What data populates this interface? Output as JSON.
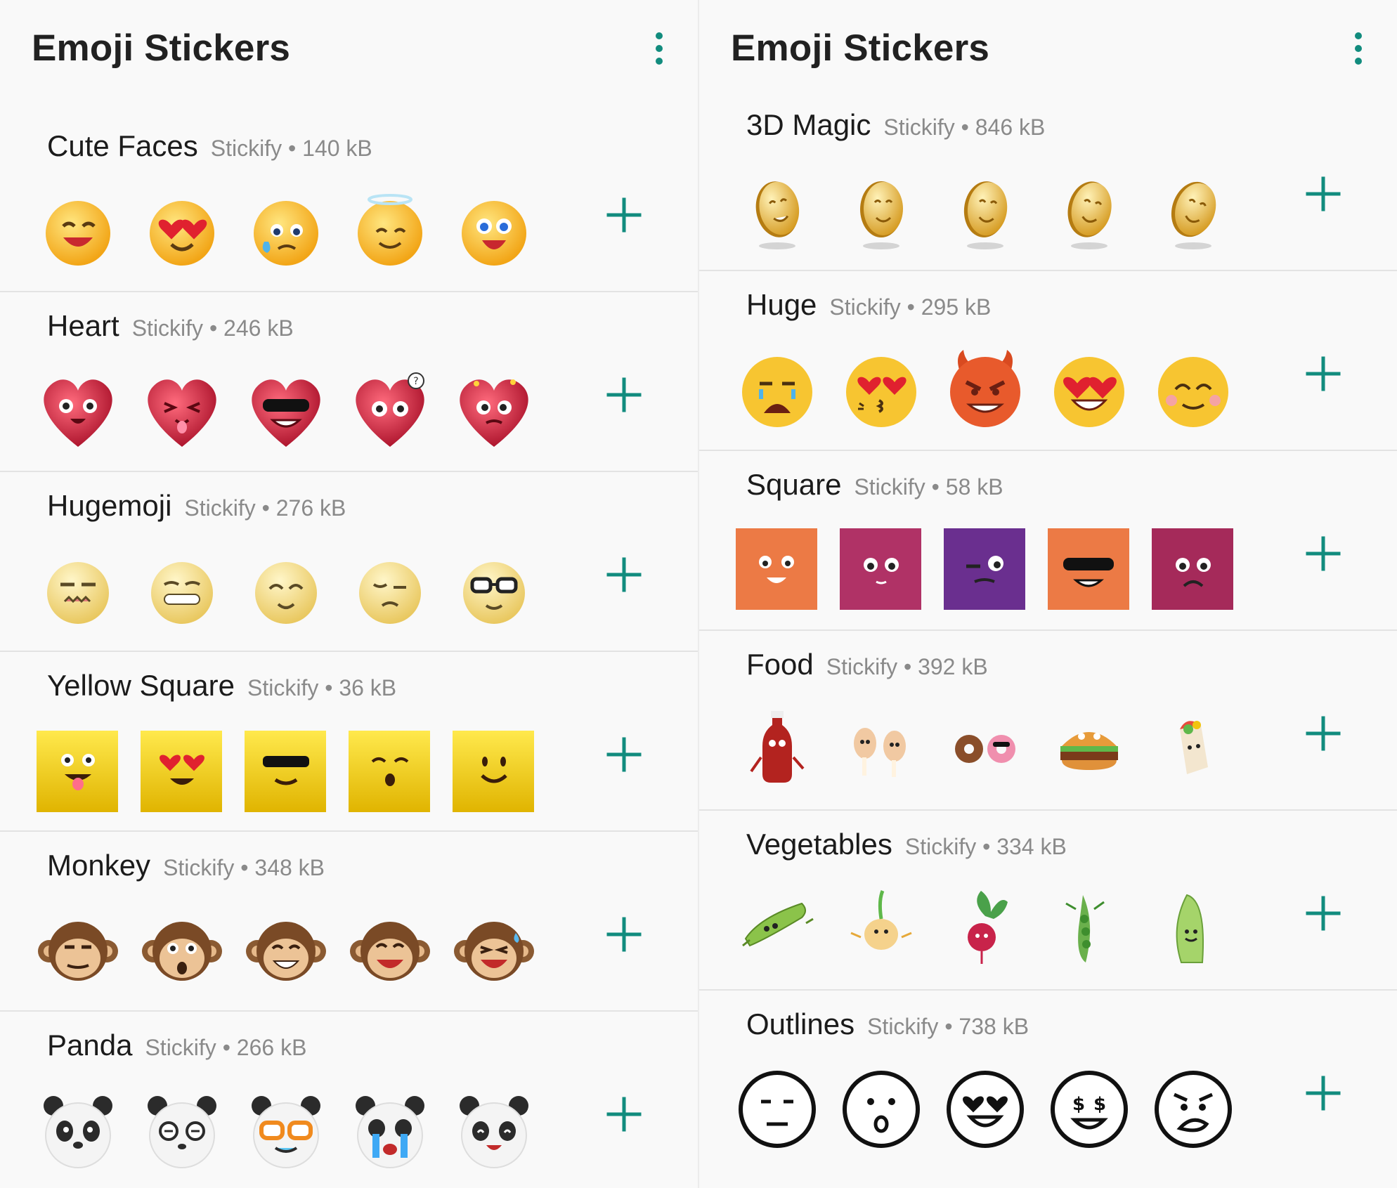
{
  "panels": [
    {
      "title": "Emoji Stickers",
      "menu_icon": "more-vert-icon",
      "packs": [
        {
          "name": "Cute Faces",
          "meta": "Stickify • 140 kB",
          "style": "yellow-face",
          "stickers": [
            "grinning-face-icon",
            "heart-eyes-face-icon",
            "sad-tear-face-icon",
            "angel-face-icon",
            "surprised-face-icon"
          ]
        },
        {
          "name": "Heart",
          "meta": "Stickify • 246 kB",
          "style": "heart",
          "stickers": [
            "heart-laughing-icon",
            "heart-tongue-icon",
            "heart-sunglasses-icon",
            "heart-question-icon",
            "heart-dizzy-icon"
          ]
        },
        {
          "name": "Hugemoji",
          "meta": "Stickify • 276 kB",
          "style": "pale-face",
          "stickers": [
            "pale-grimace-icon",
            "pale-grin-icon",
            "pale-smile-icon",
            "pale-confused-icon",
            "pale-glasses-icon"
          ]
        },
        {
          "name": "Yellow Square",
          "meta": "Stickify • 36 kB",
          "style": "yellow-square",
          "stickers": [
            "square-tongue-icon",
            "square-heart-eyes-icon",
            "square-sunglasses-icon",
            "square-wink-icon",
            "square-smile-icon"
          ]
        },
        {
          "name": "Monkey",
          "meta": "Stickify • 348 kB",
          "style": "monkey",
          "stickers": [
            "monkey-smirk-icon",
            "monkey-surprised-icon",
            "monkey-grin-icon",
            "monkey-laugh-icon",
            "monkey-sweat-icon"
          ]
        },
        {
          "name": "Panda",
          "meta": "Stickify • 266 kB",
          "style": "panda",
          "stickers": [
            "panda-neutral-icon",
            "panda-dizzy-icon",
            "panda-glasses-icon",
            "panda-crying-icon",
            "panda-happy-icon"
          ]
        }
      ]
    },
    {
      "title": "Emoji Stickers",
      "menu_icon": "more-vert-icon",
      "packs": [
        {
          "name": "3D Magic",
          "meta": "Stickify • 846 kB",
          "style": "coin",
          "stickers": [
            "coin-face-1-icon",
            "coin-face-2-icon",
            "coin-face-3-icon",
            "coin-face-4-icon",
            "coin-face-5-icon"
          ]
        },
        {
          "name": "Huge",
          "meta": "Stickify • 295 kB",
          "style": "flat-face",
          "stickers": [
            "crying-face-icon",
            "kissing-heart-face-icon",
            "devil-face-icon",
            "heart-eyes-face-icon",
            "blush-face-icon"
          ]
        },
        {
          "name": "Square",
          "meta": "Stickify • 58 kB",
          "style": "color-square",
          "stickers": [
            "orange-square-face-icon",
            "magenta-square-face-icon",
            "purple-square-face-icon",
            "orange-sunglasses-square-icon",
            "crimson-square-face-icon"
          ]
        },
        {
          "name": "Food",
          "meta": "Stickify • 392 kB",
          "style": "food",
          "stickers": [
            "ketchup-bottle-icon",
            "chicken-legs-icon",
            "donuts-icon",
            "burger-icon",
            "burrito-icon"
          ]
        },
        {
          "name": "Vegetables",
          "meta": "Stickify • 334 kB",
          "style": "veg",
          "stickers": [
            "cucumber-icon",
            "onion-icon",
            "radish-icon",
            "pea-pod-icon",
            "lettuce-icon"
          ]
        },
        {
          "name": "Outlines",
          "meta": "Stickify • 738 kB",
          "style": "outline",
          "stickers": [
            "outline-neutral-icon",
            "outline-surprised-icon",
            "outline-heart-eyes-icon",
            "outline-money-eyes-icon",
            "outline-angry-icon"
          ]
        }
      ]
    }
  ],
  "add_icon": "add-plus-icon",
  "colors": {
    "accent": "#128c7e",
    "title_text": "#1b1b1b",
    "meta_text": "#8a8a8a",
    "background": "#f9f9f9",
    "divider": "#e3e3e3",
    "emoji_yellow": "#f7c531",
    "square_orange": "#ec7a45",
    "square_magenta": "#b03266",
    "square_purple": "#6a2f8f",
    "square_crimson": "#a52a5a",
    "heart_red": "#d32f4a"
  }
}
